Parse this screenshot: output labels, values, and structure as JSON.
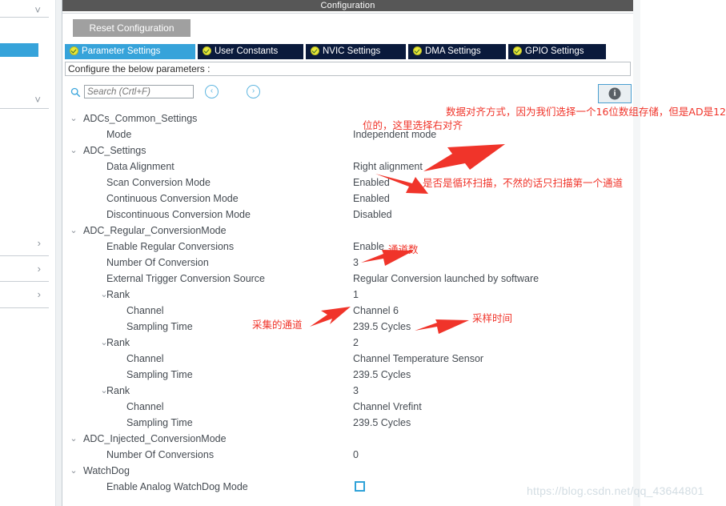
{
  "window": {
    "title": "Configuration",
    "reset_button": "Reset Configuration",
    "configure_hint": "Configure the below parameters :"
  },
  "tabs": [
    {
      "label": "Parameter Settings",
      "active": true,
      "icon": "check-circle-icon"
    },
    {
      "label": "User Constants",
      "active": false,
      "icon": "check-circle-icon"
    },
    {
      "label": "NVIC Settings",
      "active": false,
      "icon": "check-circle-icon"
    },
    {
      "label": "DMA Settings",
      "active": false,
      "icon": "check-circle-icon"
    },
    {
      "label": "GPIO Settings",
      "active": false,
      "icon": "check-circle-icon"
    }
  ],
  "toolbar": {
    "search_placeholder": "Search (Crtl+F)",
    "search_value": "",
    "prev_label": "‹",
    "next_label": "›",
    "info_label": "i"
  },
  "tree": [
    {
      "indent": 0,
      "twisty": "down",
      "label": "ADCs_Common_Settings",
      "value": ""
    },
    {
      "indent": 1,
      "twisty": "",
      "label": "Mode",
      "value": "Independent mode"
    },
    {
      "indent": 0,
      "twisty": "down",
      "label": "ADC_Settings",
      "value": ""
    },
    {
      "indent": 1,
      "twisty": "",
      "label": "Data Alignment",
      "value": "Right alignment"
    },
    {
      "indent": 1,
      "twisty": "",
      "label": "Scan Conversion Mode",
      "value": "Enabled"
    },
    {
      "indent": 1,
      "twisty": "",
      "label": "Continuous Conversion Mode",
      "value": "Enabled"
    },
    {
      "indent": 1,
      "twisty": "",
      "label": "Discontinuous Conversion Mode",
      "value": "Disabled"
    },
    {
      "indent": 0,
      "twisty": "down",
      "label": "ADC_Regular_ConversionMode",
      "value": ""
    },
    {
      "indent": 1,
      "twisty": "",
      "label": "Enable Regular Conversions",
      "value": "Enable"
    },
    {
      "indent": 1,
      "twisty": "",
      "label": "Number Of Conversion",
      "value": "3"
    },
    {
      "indent": 1,
      "twisty": "",
      "label": "External Trigger Conversion Source",
      "value": "Regular Conversion launched by software"
    },
    {
      "indent": 1,
      "twisty": "down",
      "label": "Rank",
      "value": "1"
    },
    {
      "indent": 2,
      "twisty": "",
      "label": "Channel",
      "value": "Channel 6"
    },
    {
      "indent": 2,
      "twisty": "",
      "label": "Sampling Time",
      "value": "239.5 Cycles"
    },
    {
      "indent": 1,
      "twisty": "down",
      "label": "Rank",
      "value": "2"
    },
    {
      "indent": 2,
      "twisty": "",
      "label": "Channel",
      "value": "Channel Temperature Sensor"
    },
    {
      "indent": 2,
      "twisty": "",
      "label": "Sampling Time",
      "value": "239.5 Cycles"
    },
    {
      "indent": 1,
      "twisty": "down",
      "label": "Rank",
      "value": "3"
    },
    {
      "indent": 2,
      "twisty": "",
      "label": "Channel",
      "value": "Channel Vrefint"
    },
    {
      "indent": 2,
      "twisty": "",
      "label": "Sampling Time",
      "value": "239.5 Cycles"
    },
    {
      "indent": 0,
      "twisty": "down",
      "label": "ADC_Injected_ConversionMode",
      "value": ""
    },
    {
      "indent": 1,
      "twisty": "",
      "label": "Number Of Conversions",
      "value": "0"
    },
    {
      "indent": 0,
      "twisty": "down",
      "label": "WatchDog",
      "value": ""
    },
    {
      "indent": 1,
      "twisty": "",
      "label": "Enable Analog WatchDog Mode",
      "value": "",
      "control": "checkbox",
      "checked": false
    }
  ],
  "annotations": [
    {
      "id": "anno-alignment",
      "line1": "数据对齐方式，因为我们选择一个16位数组存储，但是AD是12",
      "line2": "位的，这里选择右对齐"
    },
    {
      "id": "anno-scan",
      "text": "是否是循环扫描，不然的话只扫描第一个通道"
    },
    {
      "id": "anno-count",
      "text": "通道数"
    },
    {
      "id": "anno-channel",
      "text": "采集的通道"
    },
    {
      "id": "anno-sampling",
      "text": "采样时间"
    }
  ],
  "watermark": "https://blog.csdn.net/qq_43644801",
  "colors": {
    "tab_active": "#36a3da",
    "tab_inactive": "#0a1a3c",
    "title_bar": "#575757",
    "annotation": "#f0342a",
    "accent": "#2fa2d8"
  }
}
